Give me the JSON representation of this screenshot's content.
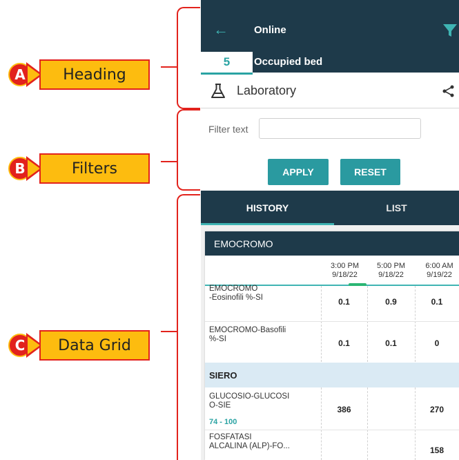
{
  "callouts": [
    {
      "letter": "A",
      "label": "Heading"
    },
    {
      "letter": "B",
      "label": "Filters"
    },
    {
      "letter": "C",
      "label": "Data Grid"
    }
  ],
  "colors": {
    "header_bg": "#1e3a4a",
    "accent": "#2a9aa0",
    "callout_fill": "#fdbc0f",
    "callout_border": "#e2221c",
    "section_bg": "#daeaf4"
  },
  "header": {
    "back_icon": "arrow-left-icon",
    "title": "Online",
    "filter_icon": "funnel-icon",
    "bed_number": "5",
    "bed_label": "Occupied bed",
    "module_icon": "flask-icon",
    "module_label": "Laboratory",
    "share_icon": "share-icon"
  },
  "filters": {
    "label": "Filter text",
    "value": "",
    "placeholder": "",
    "apply": "APPLY",
    "reset": "RESET"
  },
  "tabs": [
    {
      "label": "HISTORY",
      "active": true
    },
    {
      "label": "LIST",
      "active": false
    }
  ],
  "grid": {
    "panel_title": "EMOCROMO",
    "columns": [
      {
        "time": "3:00 PM",
        "date": "9/18/22"
      },
      {
        "time": "5:00 PM",
        "date": "9/18/22"
      },
      {
        "time": "6:00 AM",
        "date": "9/19/22"
      }
    ],
    "rows": [
      {
        "name_line1": "EMOCROMO",
        "name_line2": "-Eosinofili %-SI",
        "values": [
          "0.1",
          "0.9",
          "0.1"
        ]
      },
      {
        "name_line1": "EMOCROMO-Basofili",
        "name_line2": "%-SI",
        "values": [
          "0.1",
          "0.1",
          "0"
        ]
      }
    ],
    "section": "SIERO",
    "section_rows": [
      {
        "name_line1": "GLUCOSIO-GLUCOSI",
        "name_line2": "O-SIE",
        "range": "74 - 100",
        "values": [
          "386",
          "",
          "270"
        ]
      },
      {
        "name_line1": "FOSFATASI",
        "name_line2": "ALCALINA (ALP)-FO...",
        "values": [
          "",
          "",
          "158"
        ]
      }
    ]
  }
}
